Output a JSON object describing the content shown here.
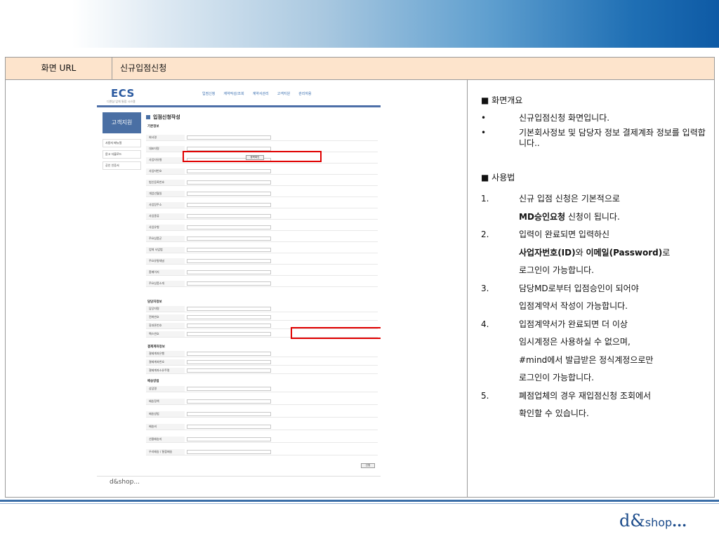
{
  "header": {
    "label": "화면 URL",
    "value": "신규입점신청"
  },
  "screenshot": {
    "logo": "ECS",
    "logo_sub": "디앤샵 업체 통합 시스템",
    "nav": [
      "입점신청",
      "계약작성/조회",
      "계약서관리",
      "고객지원",
      "관리자용"
    ],
    "side_title": "고객지원",
    "side_items": [
      "사용자 매뉴얼",
      "묻고 더블로드",
      "공인 인증서"
    ],
    "form_title": "입점신청작성",
    "sections": [
      "기본정보",
      "담당자정보",
      "결제계좌정보",
      "배송방법"
    ],
    "fields": [
      "회사명",
      "대표자명",
      "사업자유형",
      "사업자번호",
      "법인등록번호",
      "개업년월일",
      "사업장주소",
      "사업종류",
      "사업유형",
      "주요상품군",
      "업체 사업범",
      "주요유통채널",
      "홈페이지",
      "주요상품소개"
    ],
    "contact_fields": [
      "담당자명",
      "전화번호",
      "휴대폰번호",
      "팩스번호"
    ],
    "bank_fields": [
      "결제계좌은행",
      "결제계좌번호",
      "결제계좌소유주명"
    ],
    "ship_fields": [
      "상담명",
      "배송정책",
      "배송방법",
      "배송비",
      "선물배송지",
      "우리배송 / 통합배송"
    ],
    "btn_check": "중복확인",
    "btn_submit": "신청",
    "homepage_value": "http://",
    "footer_logo": "d&shop..."
  },
  "desc": {
    "overview_title": "■ 화면개요",
    "overview": [
      {
        "marker": "•",
        "text": "신규입점신청 화면입니다."
      },
      {
        "marker": "•",
        "text": "기본회사정보 및 담당자 정보 결제계좌 정보를 입력합니다.."
      }
    ],
    "usage_title": "■ 사용법",
    "s1_num": "1.",
    "s1_a": "신규 입점 신청은 기본적으로",
    "s1_b_bold": "MD승인요청",
    "s1_b": " 신청이 됩니다.",
    "s2_num": "2.",
    "s2_a": "입력이 완료되면 입력하신",
    "s2_b_bold1": "사업자번호(ID)",
    "s2_b_mid": "와 ",
    "s2_b_bold2": "이메일(Password)",
    "s2_b_end": "로",
    "s2_c": "로그인이 가능합니다.",
    "s3_num": "3.",
    "s3_a": "담당MD로부터 입점승인이 되어야",
    "s3_b": "입점계약서 작성이 가능합니다.",
    "s4_num": "4.",
    "s4_a": "입점계약서가 완료되면 더 이상",
    "s4_b": "임시계정은 사용하실 수 없으며,",
    "s4_c": "#mind에서 발급받은 정식계정으로만",
    "s4_d": "로그인이 가능합니다.",
    "s5_num": "5.",
    "s5_a": "폐점업체의 경우 재입점신청 조회에서",
    "s5_b": "확인할 수 있습니다."
  },
  "brand": {
    "main": "d&",
    "small": "shop",
    "dots": "..."
  }
}
